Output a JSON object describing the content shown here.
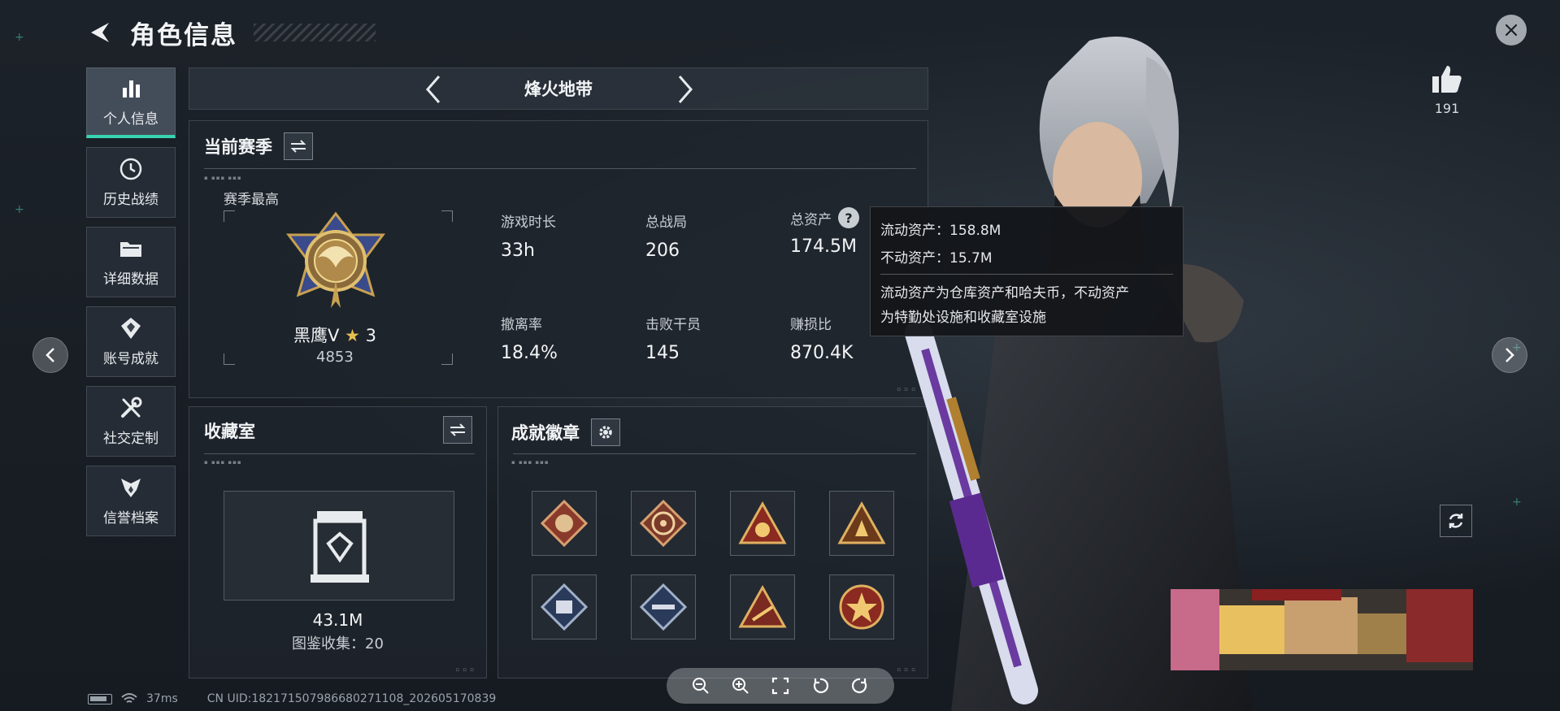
{
  "header": {
    "title": "角色信息"
  },
  "sidenav": {
    "items": [
      {
        "label": "个人信息",
        "icon": "bar-chart-icon",
        "active": true
      },
      {
        "label": "历史战绩",
        "icon": "history-clock-icon"
      },
      {
        "label": "详细数据",
        "icon": "folder-icon"
      },
      {
        "label": "账号成就",
        "icon": "achievement-icon"
      },
      {
        "label": "社交定制",
        "icon": "tools-icon"
      },
      {
        "label": "信誉档案",
        "icon": "credit-shield-icon"
      }
    ]
  },
  "mode": {
    "title": "烽火地带"
  },
  "season": {
    "title": "当前赛季",
    "best_label": "赛季最高",
    "rank_name": "黑鹰Ⅴ",
    "rank_stars": "3",
    "rank_score": "4853",
    "stats": [
      {
        "label": "游戏时长",
        "value": "33h"
      },
      {
        "label": "总战局",
        "value": "206"
      },
      {
        "label": "总资产",
        "value": "174.5M"
      },
      {
        "label": "撤离率",
        "value": "18.4%"
      },
      {
        "label": "击败干员",
        "value": "145"
      },
      {
        "label": "赚损比",
        "value": "870.4K"
      }
    ]
  },
  "tooltip": {
    "liquid": "流动资产：158.8M",
    "fixed": "不动资产：15.7M",
    "desc_line1": "流动资产为仓库资产和哈夫币，不动资产",
    "desc_line2": "为特勤处设施和收藏室设施"
  },
  "collection": {
    "title": "收藏室",
    "value": "43.1M",
    "count": "图鉴收集：20"
  },
  "badges": {
    "title": "成就徽章",
    "items": [
      "diamond-badge-icon",
      "diamond-badge-icon",
      "triangle-badge-icon",
      "triangle-badge-icon",
      "diamond-badge-icon",
      "diamond-badge-icon",
      "triangle-badge-icon",
      "circle-badge-icon"
    ]
  },
  "likes": {
    "count": "191"
  },
  "status": {
    "ping": "37ms",
    "uid": "CN UID:1821715079866802711​08_202605170839"
  },
  "colors": {
    "accent": "#38d3b3",
    "panel": "#1e242c",
    "gold": "#c8a050"
  }
}
